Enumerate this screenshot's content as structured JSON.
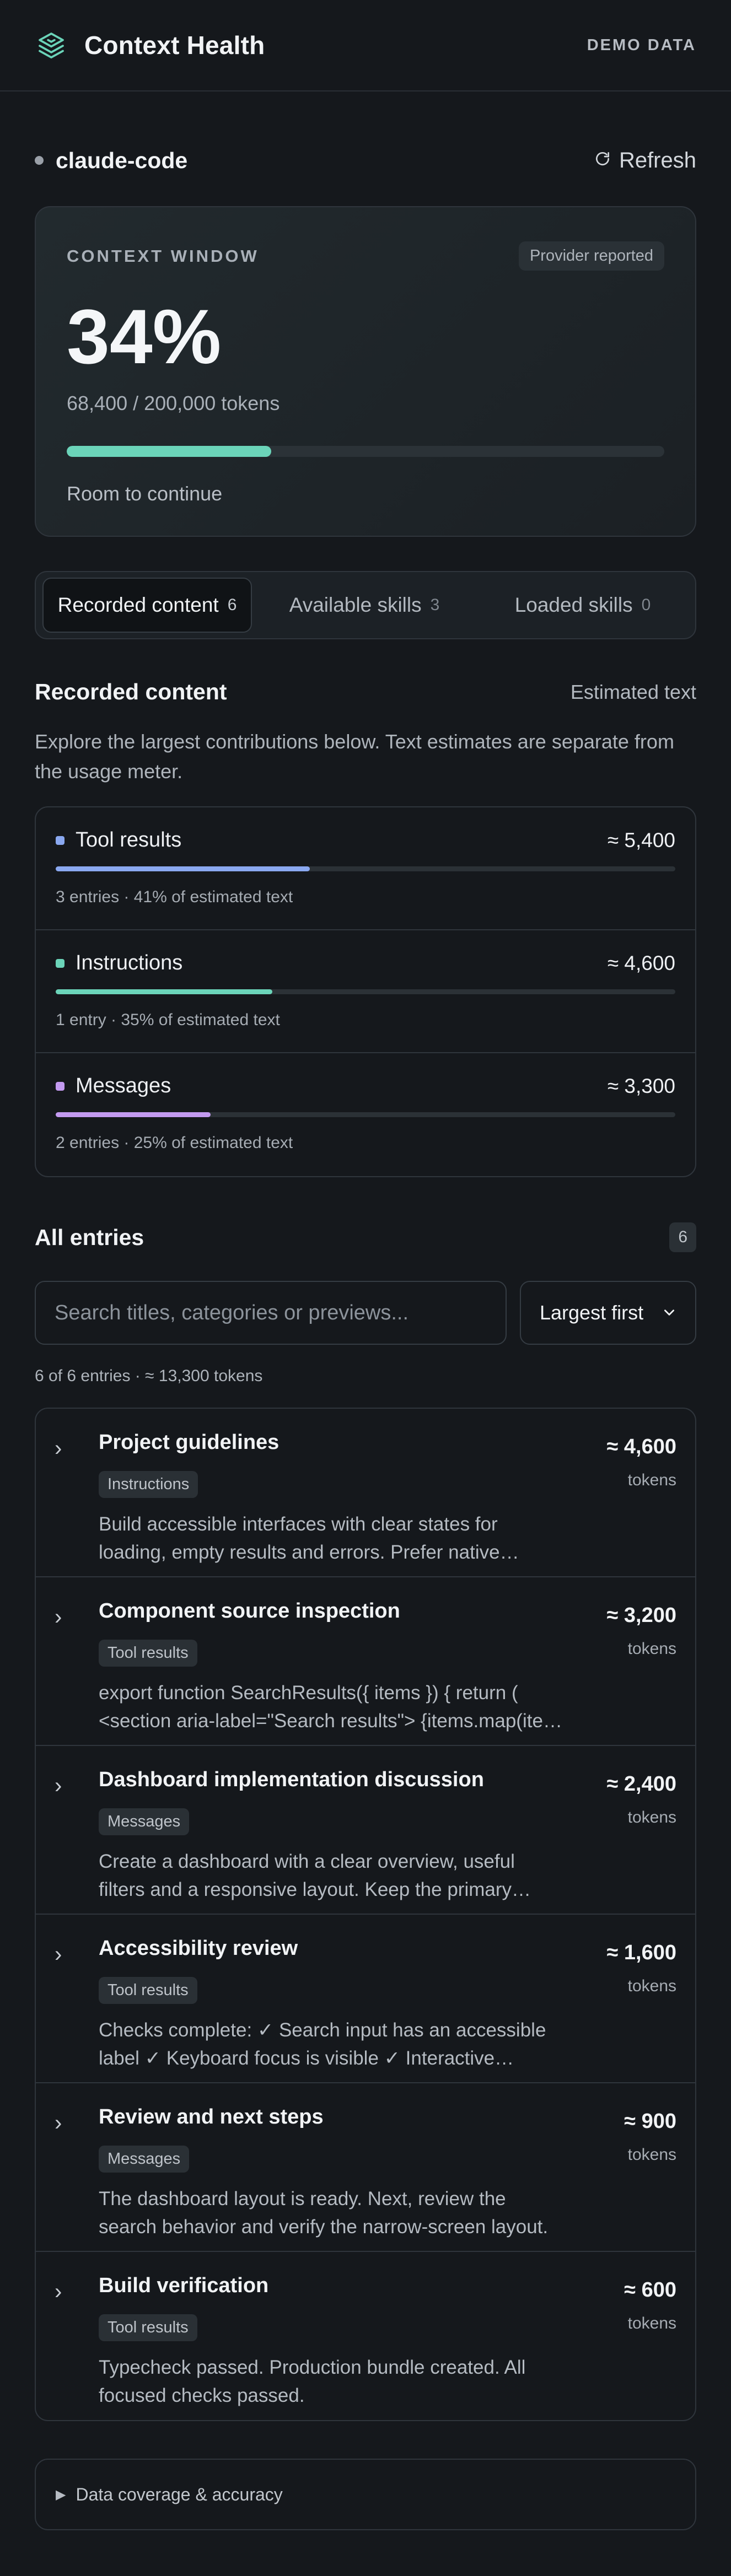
{
  "header": {
    "title": "Context Health",
    "demo_label": "DEMO DATA"
  },
  "source": {
    "name": "claude-code",
    "refresh_label": "Refresh"
  },
  "context_window": {
    "label": "CONTEXT WINDOW",
    "provider_badge": "Provider reported",
    "percent_text": "34%",
    "percent_value": 34.2,
    "tokens_text": "68,400 / 200,000 tokens",
    "status": "Room to continue",
    "accent_color": "#6bd4b9"
  },
  "tabs": [
    {
      "label": "Recorded content",
      "count": "6",
      "active": true
    },
    {
      "label": "Available skills",
      "count": "3",
      "active": false
    },
    {
      "label": "Loaded skills",
      "count": "0",
      "active": false
    }
  ],
  "recorded": {
    "title": "Recorded content",
    "meta": "Estimated text",
    "description": "Explore the largest contributions below. Text estimates are separate from the usage meter.",
    "categories": [
      {
        "name": "Tool results",
        "value": "≈ 5,400",
        "share": 41,
        "subtitle": "3 entries · 41% of estimated text",
        "color": "#8aa8f0"
      },
      {
        "name": "Instructions",
        "value": "≈ 4,600",
        "share": 35,
        "subtitle": "1 entry · 35% of estimated text",
        "color": "#6bd4b9"
      },
      {
        "name": "Messages",
        "value": "≈ 3,300",
        "share": 25,
        "subtitle": "2 entries · 25% of estimated text",
        "color": "#c39af0"
      }
    ]
  },
  "entries": {
    "title": "All entries",
    "count": "6",
    "search_placeholder": "Search titles, categories or previews...",
    "sort_label": "Largest first",
    "results_meta": "6 of 6 entries · ≈ 13,300 tokens",
    "unit": "tokens",
    "items": [
      {
        "title": "Project guidelines",
        "tag": "Instructions",
        "value": "≈ 4,600",
        "preview": "Build accessible interfaces with clear states for loading, empty results and errors. Prefer native controls and reus..."
      },
      {
        "title": "Component source inspection",
        "tag": "Tool results",
        "value": "≈ 3,200",
        "preview": "export function SearchResults({ items }) { return ( <section aria-label=\"Search results\"> {items.map(item =..."
      },
      {
        "title": "Dashboard implementation discussion",
        "tag": "Messages",
        "value": "≈ 2,400",
        "preview": "Create a dashboard with a clear overview, useful filters and a responsive layout. Keep the primary action visible..."
      },
      {
        "title": "Accessibility review",
        "tag": "Tool results",
        "value": "≈ 1,600",
        "preview": "Checks complete: ✓ Search input has an accessible label ✓ Keyboard focus is visible ✓ Interactive controls suppo..."
      },
      {
        "title": "Review and next steps",
        "tag": "Messages",
        "value": "≈ 900",
        "preview": "The dashboard layout is ready. Next, review the search behavior and verify the narrow-screen layout."
      },
      {
        "title": "Build verification",
        "tag": "Tool results",
        "value": "≈ 600",
        "preview": "Typecheck passed. Production bundle created. All focused checks passed."
      }
    ]
  },
  "coverage": {
    "label": "Data coverage & accuracy"
  }
}
